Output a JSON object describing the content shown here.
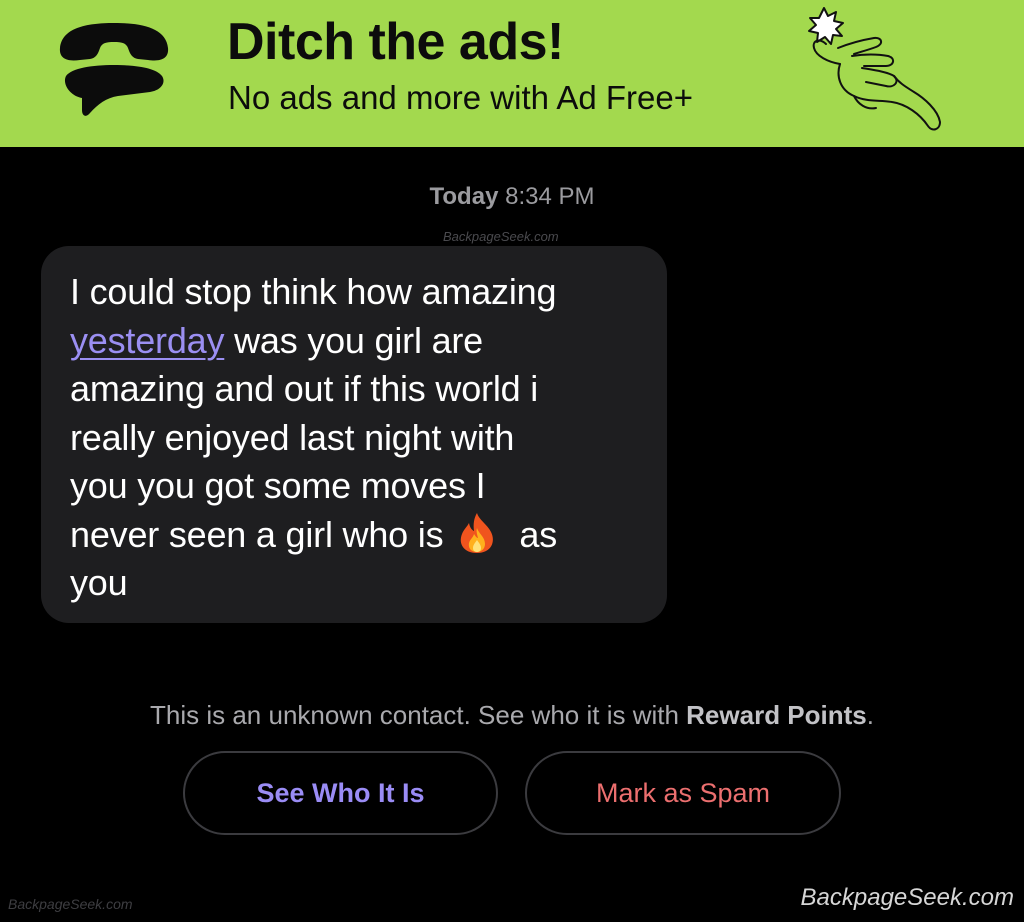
{
  "ad": {
    "title": "Ditch the ads!",
    "subtitle": "No ads and more with Ad Free+",
    "logo_icon": "textnow-logo-icon",
    "hand_icon": "hand-snap-icon",
    "background": "#a3d94e"
  },
  "conversation": {
    "timestamp_day": "Today",
    "timestamp_time": "8:34 PM",
    "message": {
      "lines": [
        "I could stop think how amazing",
        "was you girl are",
        "amazing and out if this world i",
        "really enjoyed last night with",
        "you you got some moves I",
        "never seen a girl who is",
        "as",
        "you"
      ],
      "link_word": "yesterday",
      "emoji": "fire-icon"
    }
  },
  "notice": {
    "text": "This is an unknown contact. See who it is with ",
    "highlight": "Reward Points",
    "period": "."
  },
  "buttons": {
    "see_who": "See Who It Is",
    "spam": "Mark as Spam"
  },
  "watermarks": {
    "top": "BackpageSeek.com",
    "bottom_left": "BackpageSeek.com",
    "bottom_right": "BackpageSeek.com"
  },
  "colors": {
    "link": "#9b8ff2",
    "see_who": "#9a8cf5",
    "spam": "#ec6f6f",
    "bubble": "#1e1e20"
  }
}
